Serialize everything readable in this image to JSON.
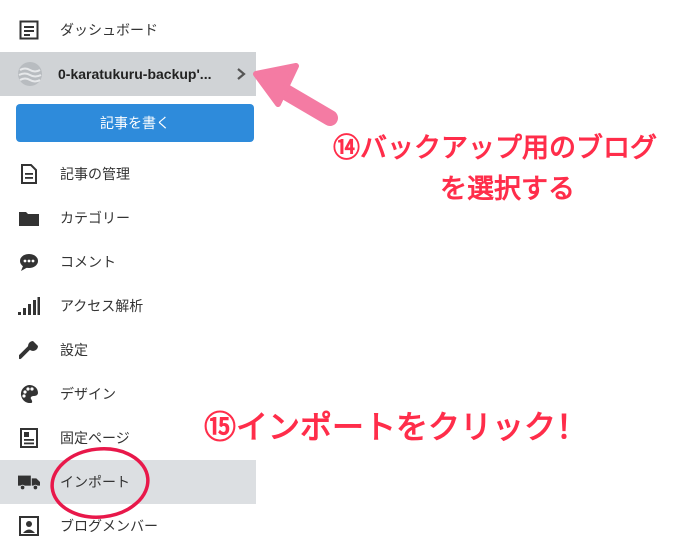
{
  "sidebar": {
    "dashboard": {
      "label": "ダッシュボード",
      "icon": "dashboard-icon"
    },
    "blog_selector": {
      "name": "0-karatukuru-backup'...",
      "icon": "blog-favicon-icon"
    },
    "write_button": {
      "label": "記事を書く"
    },
    "items": [
      {
        "label": "記事の管理",
        "icon": "document-icon"
      },
      {
        "label": "カテゴリー",
        "icon": "folder-icon"
      },
      {
        "label": "コメント",
        "icon": "comment-icon"
      },
      {
        "label": "アクセス解析",
        "icon": "bar-chart-icon"
      },
      {
        "label": "設定",
        "icon": "wrench-icon"
      },
      {
        "label": "デザイン",
        "icon": "palette-icon"
      },
      {
        "label": "固定ページ",
        "icon": "page-icon"
      },
      {
        "label": "インポート",
        "icon": "truck-icon"
      },
      {
        "label": "ブログメンバー",
        "icon": "member-icon"
      }
    ]
  },
  "annotations": {
    "step14_line1": "⑭バックアップ用のブログ",
    "step14_line2": "を選択する",
    "step15": "⑮インポートをクリック！",
    "color": "#ff2d4a",
    "arrow_color": "#f47ba3",
    "circle_color": "#e8184a"
  },
  "colors": {
    "accent_button": "#2e8bdb",
    "selected_row": "#dcdfe2"
  }
}
